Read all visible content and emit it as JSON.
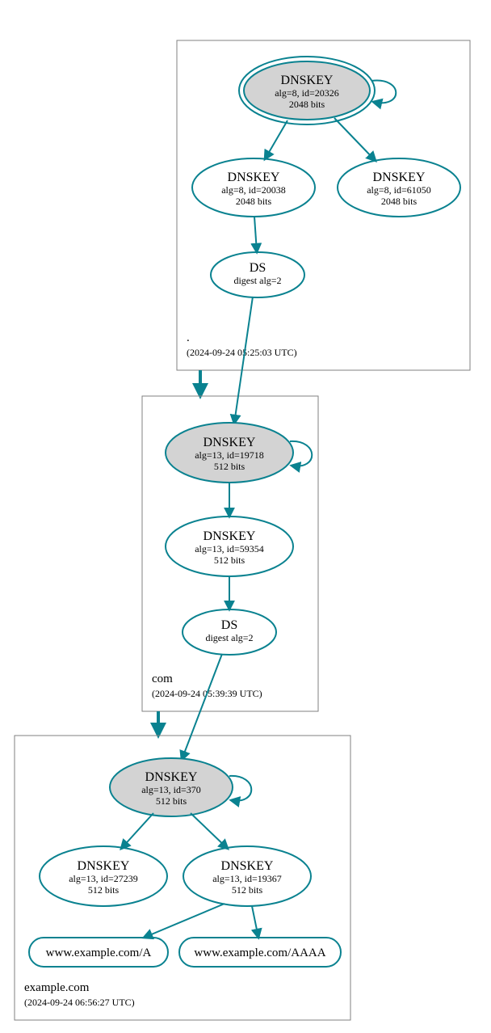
{
  "zones": {
    "root": {
      "name": ".",
      "timestamp": "(2024-09-24 05:25:03 UTC)",
      "ksk": {
        "title": "DNSKEY",
        "line1": "alg=8, id=20326",
        "line2": "2048 bits"
      },
      "zsk1": {
        "title": "DNSKEY",
        "line1": "alg=8, id=20038",
        "line2": "2048 bits"
      },
      "zsk2": {
        "title": "DNSKEY",
        "line1": "alg=8, id=61050",
        "line2": "2048 bits"
      },
      "ds": {
        "title": "DS",
        "line1": "digest alg=2"
      }
    },
    "com": {
      "name": "com",
      "timestamp": "(2024-09-24 05:39:39 UTC)",
      "ksk": {
        "title": "DNSKEY",
        "line1": "alg=13, id=19718",
        "line2": "512 bits"
      },
      "zsk": {
        "title": "DNSKEY",
        "line1": "alg=13, id=59354",
        "line2": "512 bits"
      },
      "ds": {
        "title": "DS",
        "line1": "digest alg=2"
      }
    },
    "example": {
      "name": "example.com",
      "timestamp": "(2024-09-24 06:56:27 UTC)",
      "ksk": {
        "title": "DNSKEY",
        "line1": "alg=13, id=370",
        "line2": "512 bits"
      },
      "zsk1": {
        "title": "DNSKEY",
        "line1": "alg=13, id=27239",
        "line2": "512 bits"
      },
      "zsk2": {
        "title": "DNSKEY",
        "line1": "alg=13, id=19367",
        "line2": "512 bits"
      },
      "recA": {
        "label": "www.example.com/A"
      },
      "recAAAA": {
        "label": "www.example.com/AAAA"
      }
    }
  }
}
